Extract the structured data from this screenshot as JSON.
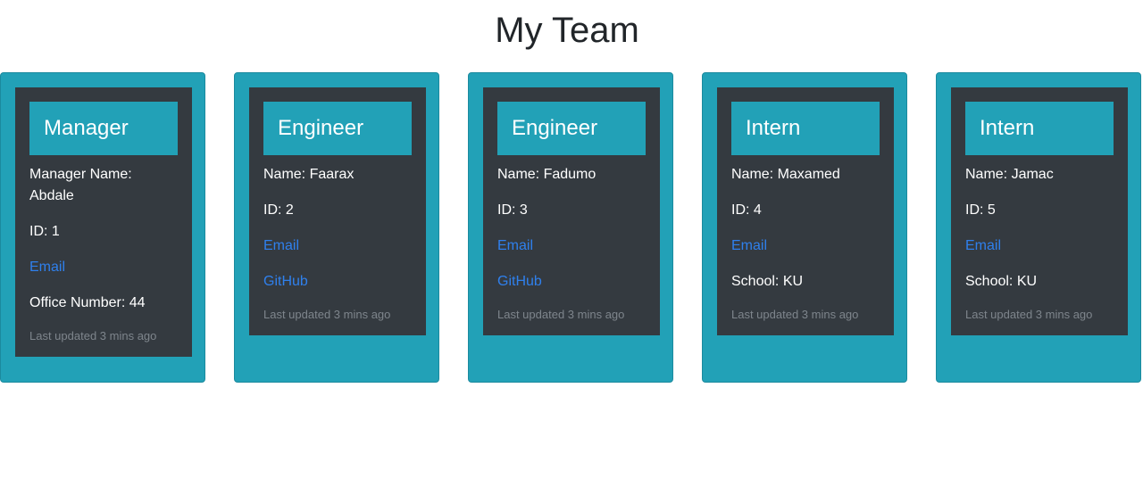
{
  "header": {
    "title": "My Team"
  },
  "cards": [
    {
      "role": "Manager",
      "name_text": "Manager Name: Abdale",
      "id_text": "ID: 1",
      "email_label": "Email",
      "extra_text": "Office Number: 44",
      "updated": "Last updated 3 mins ago"
    },
    {
      "role": "Engineer",
      "name_text": "Name: Faarax",
      "id_text": "ID: 2",
      "email_label": "Email",
      "github_label": "GitHub",
      "updated": "Last updated 3 mins ago"
    },
    {
      "role": "Engineer",
      "name_text": "Name: Fadumo",
      "id_text": "ID: 3",
      "email_label": "Email",
      "github_label": "GitHub",
      "updated": "Last updated 3 mins ago"
    },
    {
      "role": "Intern",
      "name_text": "Name: Maxamed",
      "id_text": "ID: 4",
      "email_label": "Email",
      "extra_text": "School: KU",
      "updated": "Last updated 3 mins ago"
    },
    {
      "role": "Intern",
      "name_text": "Name: Jamac",
      "id_text": "ID: 5",
      "email_label": "Email",
      "extra_text": "School: KU",
      "updated": "Last updated 3 mins ago"
    }
  ],
  "colors": {
    "card_accent": "#22a1b7",
    "card_body": "#343a40",
    "link": "#2f80ed",
    "muted": "#7e858c"
  }
}
